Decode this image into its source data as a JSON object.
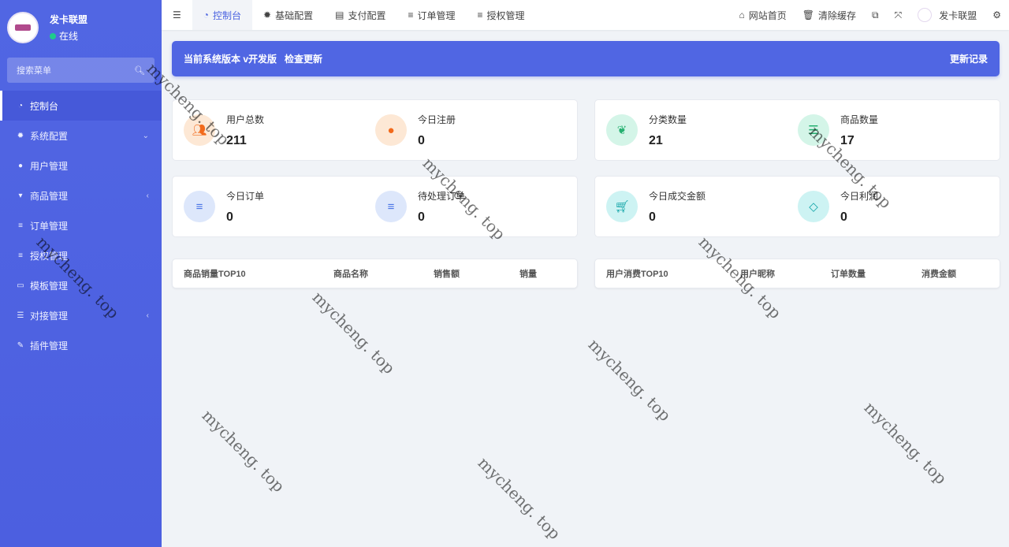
{
  "sidebar": {
    "user_name": "发卡联盟",
    "status": "在线",
    "search_placeholder": "搜索菜单",
    "items": [
      {
        "label": "控制台",
        "icon": "dashboard-icon"
      },
      {
        "label": "系统配置",
        "icon": "gear-icon"
      },
      {
        "label": "用户管理",
        "icon": "user-icon"
      },
      {
        "label": "商品管理",
        "icon": "cart-icon"
      },
      {
        "label": "订单管理",
        "icon": "list-icon"
      },
      {
        "label": "授权管理",
        "icon": "list-icon"
      },
      {
        "label": "模板管理",
        "icon": "template-icon"
      },
      {
        "label": "对接管理",
        "icon": "sliders-icon"
      },
      {
        "label": "插件管理",
        "icon": "plug-icon"
      }
    ]
  },
  "topbar": {
    "tabs": [
      {
        "label": "控制台"
      },
      {
        "label": "基础配置"
      },
      {
        "label": "支付配置"
      },
      {
        "label": "订单管理"
      },
      {
        "label": "授权管理"
      }
    ],
    "home": "网站首页",
    "clear_cache": "清除缓存",
    "user": "发卡联盟"
  },
  "banner": {
    "version": "当前系统版本 v开发版",
    "check": "检查更新",
    "changelog": "更新记录"
  },
  "stats": [
    {
      "label": "用户总数",
      "value": "211"
    },
    {
      "label": "今日注册",
      "value": "0"
    },
    {
      "label": "分类数量",
      "value": "21"
    },
    {
      "label": "商品数量",
      "value": "17"
    },
    {
      "label": "今日订单",
      "value": "0"
    },
    {
      "label": "待处理订单",
      "value": "0"
    },
    {
      "label": "今日成交金额",
      "value": "0"
    },
    {
      "label": "今日利润",
      "value": "0"
    }
  ],
  "goods_table": {
    "headers": [
      "商品销量TOP10",
      "商品名称",
      "销售额",
      "销量"
    ]
  },
  "user_table": {
    "headers": [
      "用户消费TOP10",
      "用户昵称",
      "订单数量",
      "消费金额"
    ]
  },
  "watermark": "mycheng. top",
  "colors": {
    "primary": "#5066e3"
  }
}
